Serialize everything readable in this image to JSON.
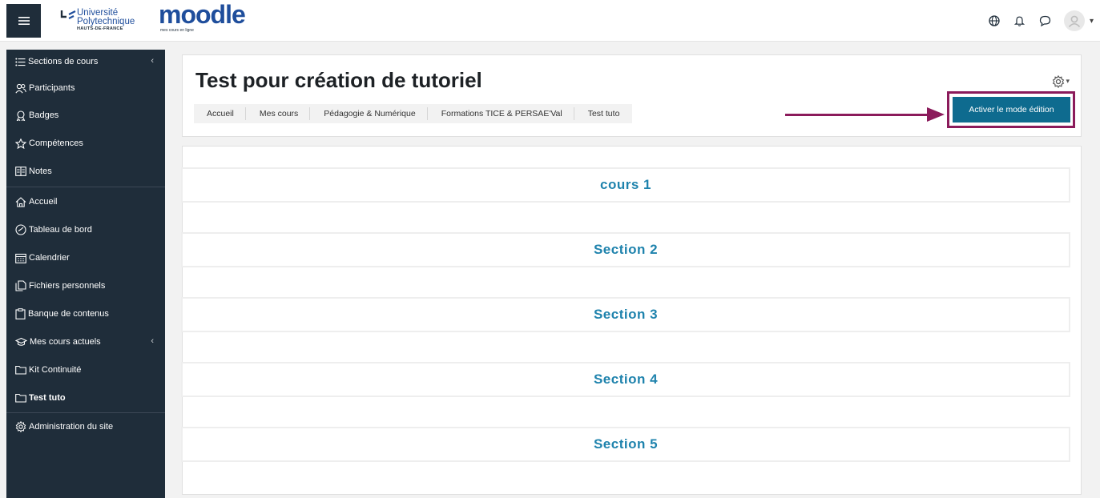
{
  "topbar": {
    "menu_icon": "hamburger-icon",
    "university": {
      "line1": "Université",
      "line2": "Polytechnique",
      "sub": "HAUTS-DE-FRANCE"
    },
    "moodle": {
      "word": "moodle",
      "tagline": "mes cours en ligne"
    },
    "icons": [
      "globe-icon",
      "bell-icon",
      "chat-icon",
      "user-avatar",
      "chevron-down-icon"
    ]
  },
  "sidebar": {
    "items": [
      {
        "label": "Sections de cours",
        "icon": "list-icon",
        "chevron": "‹"
      },
      {
        "label": "Participants",
        "icon": "people-icon"
      },
      {
        "label": "Badges",
        "icon": "badge-icon"
      },
      {
        "label": "Compétences",
        "icon": "star-icon"
      },
      {
        "label": "Notes",
        "icon": "grades-icon"
      },
      {
        "label": "Accueil",
        "icon": "home-icon"
      },
      {
        "label": "Tableau de bord",
        "icon": "dashboard-icon"
      },
      {
        "label": "Calendrier",
        "icon": "calendar-icon"
      },
      {
        "label": "Fichiers personnels",
        "icon": "files-icon"
      },
      {
        "label": "Banque de contenus",
        "icon": "clipboard-icon"
      },
      {
        "label": "Mes cours actuels",
        "icon": "graduation-icon",
        "chevron": "‹"
      },
      {
        "label": "Kit Continuité",
        "icon": "folder-icon"
      },
      {
        "label": "Test tuto",
        "icon": "folder-icon"
      },
      {
        "label": "Administration du site",
        "icon": "gear-icon"
      }
    ]
  },
  "course": {
    "title": "Test pour création de tutoriel",
    "breadcrumb": [
      "Accueil",
      "Mes cours",
      "Pédagogie & Numérique",
      "Formations TICE & PERSAE'Val",
      "Test tuto"
    ],
    "edit_button": "Activer le mode édition",
    "settings_icon": "gear-icon"
  },
  "sections": [
    "cours 1",
    "Section 2",
    "Section 3",
    "Section 4",
    "Section 5"
  ],
  "colors": {
    "sidebar_bg": "#1f2d3a",
    "accent": "#0e6b8f",
    "section_text": "#1f83ad",
    "annotation": "#8b1b5b",
    "brand": "#1f4e9c"
  }
}
